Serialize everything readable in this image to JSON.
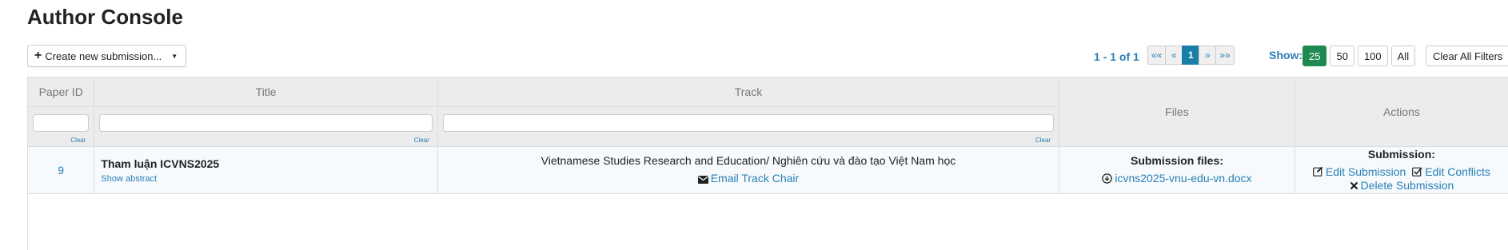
{
  "page_title": "Author Console",
  "create_button": {
    "label": "Create new submission..."
  },
  "pagination": {
    "info": "1 - 1 of 1",
    "buttons": [
      "««",
      "«",
      "1",
      "»",
      "»»"
    ],
    "active_page": "1"
  },
  "page_size": {
    "label": "Show:",
    "options": [
      "25",
      "50",
      "100",
      "All"
    ],
    "selected": "25"
  },
  "clear_all_filters": "Clear All Filters",
  "columns": {
    "paper_id": "Paper ID",
    "title": "Title",
    "track": "Track",
    "files": "Files",
    "actions": "Actions"
  },
  "filter_clear_label": "Clear",
  "rows": [
    {
      "paper_id": "9",
      "title": "Tham luận ICVNS2025",
      "show_abstract": "Show abstract",
      "track": "Vietnamese Studies Research and Education/ Nghiên cứu và đào tạo Việt Nam học",
      "email_track_chair": "Email Track Chair",
      "files_heading": "Submission files:",
      "file_name": "icvns2025-vnu-edu-vn.docx",
      "actions_heading": "Submission:",
      "edit_submission": "Edit Submission",
      "edit_conflicts": "Edit Conflicts",
      "delete_submission": "Delete Submission"
    }
  ],
  "colors": {
    "link": "#2a7fb5",
    "active_page": "#1a7fa8",
    "active_show": "#1e8a50",
    "header_bg": "#ececec",
    "row_bg": "#f6fafd"
  },
  "icons": {
    "create": "plus-icon",
    "email": "envelope-icon",
    "file": "download-circle-icon",
    "edit": "edit-icon",
    "conflicts": "checkbox-icon",
    "delete": "x-icon"
  }
}
